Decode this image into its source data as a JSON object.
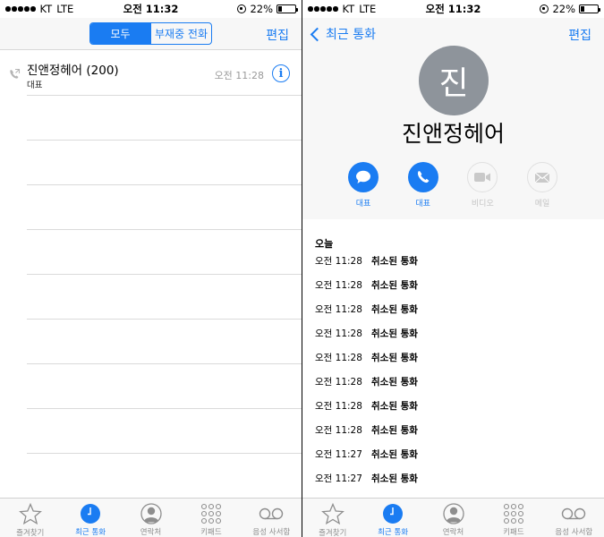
{
  "status_left": {
    "carrier": "KT",
    "network": "LTE",
    "time": "오전 11:32",
    "battery": "22%"
  },
  "status_right": {
    "carrier": "KT",
    "network": "LTE",
    "time": "오전 11:32",
    "battery": "22%"
  },
  "battery_level": 0.22,
  "recents": {
    "segment_all": "모두",
    "segment_missed": "부재중 전화",
    "edit_label": "편집",
    "entries": [
      {
        "name": "진앤정헤어 (200)",
        "label": "대표",
        "time": "오전 11:28"
      }
    ]
  },
  "detail": {
    "back_label": "최근 통화",
    "edit_label": "편집",
    "avatar_initial": "진",
    "contact_name": "진앤정헤어",
    "actions": [
      {
        "id": "message",
        "label": "대표"
      },
      {
        "id": "call",
        "label": "대표"
      },
      {
        "id": "video",
        "label": "비디오"
      },
      {
        "id": "mail",
        "label": "메일"
      }
    ],
    "section_title": "오늘",
    "history": [
      {
        "time": "오전 11:28",
        "status": "취소된 통화"
      },
      {
        "time": "오전 11:28",
        "status": "취소된 통화"
      },
      {
        "time": "오전 11:28",
        "status": "취소된 통화"
      },
      {
        "time": "오전 11:28",
        "status": "취소된 통화"
      },
      {
        "time": "오전 11:28",
        "status": "취소된 통화"
      },
      {
        "time": "오전 11:28",
        "status": "취소된 통화"
      },
      {
        "time": "오전 11:28",
        "status": "취소된 통화"
      },
      {
        "time": "오전 11:28",
        "status": "취소된 통화"
      },
      {
        "time": "오전 11:27",
        "status": "취소된 통화"
      },
      {
        "time": "오전 11:27",
        "status": "취소된 통화"
      }
    ]
  },
  "tabbar": {
    "favorites": "즐겨찾기",
    "recents": "최근 통화",
    "contacts": "연락처",
    "keypad": "키패드",
    "voicemail": "음성 사서함"
  },
  "colors": {
    "accent": "#1a7cf2",
    "avatar": "#8e949b"
  }
}
